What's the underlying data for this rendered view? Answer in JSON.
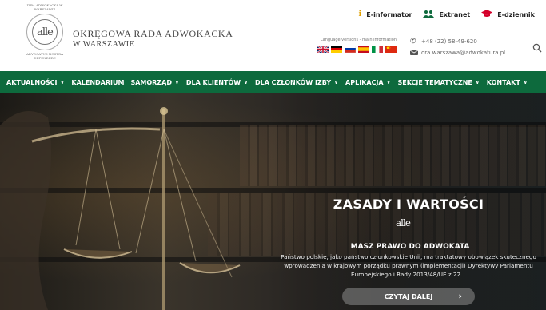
{
  "header": {
    "top_links": [
      {
        "label": "E-informator",
        "icon": "info-icon",
        "color": "#e0a000"
      },
      {
        "label": "Extranet",
        "icon": "users-icon",
        "color": "#0d6a3d"
      },
      {
        "label": "E-dziennik",
        "icon": "graduation-cap-icon",
        "color": "#d4002a"
      }
    ],
    "logo": {
      "top_text": "IZBA ADWOKACKA W WARSZAWIE",
      "mark": "alle",
      "bottom_text": "ADVOCATUS NOSTRA DEFENDERE"
    },
    "org_name_line1": "Okręgowa Rada Adwokacka",
    "org_name_line2": "w Warszawie",
    "language_label": "Language versions - main information",
    "flags": [
      "english-flag-icon",
      "german-flag-icon",
      "russian-flag-icon",
      "spanish-flag-icon",
      "italian-flag-icon",
      "chinese-flag-icon"
    ],
    "phone": "+48 (22) 58-49-620",
    "email": "ora.warszawa@adwokatura.pl",
    "search_icon": "search-icon"
  },
  "nav": {
    "items": [
      {
        "label": "AKTUALNOŚCI",
        "dropdown": true
      },
      {
        "label": "KALENDARIUM",
        "dropdown": false
      },
      {
        "label": "SAMORZĄD",
        "dropdown": true
      },
      {
        "label": "DLA KLIENTÓW",
        "dropdown": true
      },
      {
        "label": "DLA CZŁONKÓW IZBY",
        "dropdown": true
      },
      {
        "label": "APLIKACJA",
        "dropdown": true
      },
      {
        "label": "SEKCJE TEMATYCZNE",
        "dropdown": true
      },
      {
        "label": "KONTAKT",
        "dropdown": true
      }
    ],
    "background": "#0d6a3d"
  },
  "hero": {
    "title": "ZASADY I WARTOŚCI",
    "mini_logo": "alle",
    "subtitle": "MASZ PRAWO DO ADWOKATA",
    "text": "Państwo polskie, jako państwo członkowskie Unii, ma traktatowy obowiązek skutecznego wprowadzenia w krajowym porządku prawnym (implementacji) Dyrektywy Parlamentu Europejskiego i Rady 2013/48/UE z 22...",
    "cta_label": "CZYTAJ DALEJ",
    "cta_arrow": "›"
  }
}
